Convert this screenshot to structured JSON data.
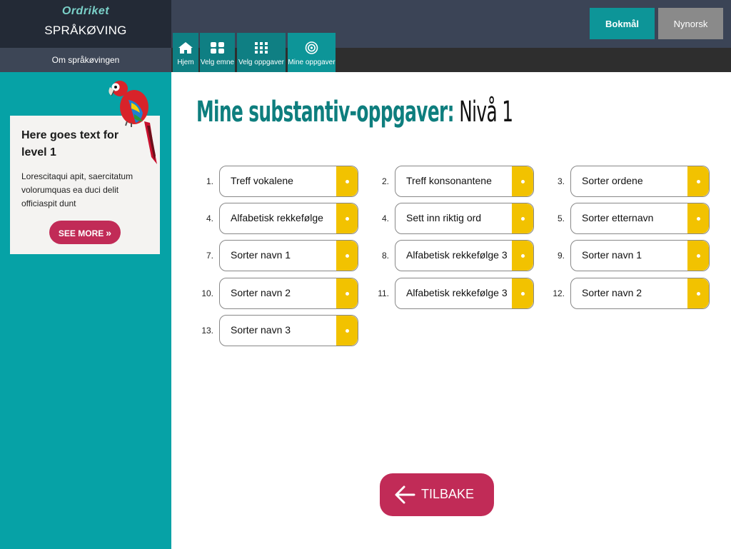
{
  "brand": {
    "logo": "Ordriket",
    "title": "SPRÅKØVING"
  },
  "about": {
    "label": "Om språkøvingen"
  },
  "language": {
    "bokmal": "Bokmål",
    "nynorsk": "Nynorsk",
    "active": "Bokmål"
  },
  "nav": [
    {
      "label": "Hjem",
      "icon": "home-icon"
    },
    {
      "label": "Velg emne",
      "icon": "grid-4-icon"
    },
    {
      "label": "Velg oppgaver",
      "icon": "grid-9-icon"
    },
    {
      "label": "Mine oppgaver",
      "icon": "target-icon",
      "active": true
    }
  ],
  "sidebar": {
    "card_title": "Here goes text for level 1",
    "card_body": "Lorescitaqui apit, saercitatum volorumquas ea duci delit officiaspit dunt",
    "see_more": "SEE MORE"
  },
  "heading": {
    "main": "Mine substantiv-oppgaver:",
    "level": "Nivå 1"
  },
  "tasks": [
    {
      "num": "1.",
      "label": "Treff vokalene"
    },
    {
      "num": "2.",
      "label": "Treff konsonantene"
    },
    {
      "num": "3.",
      "label": "Sorter ordene"
    },
    {
      "num": "4.",
      "label": "Alfabetisk rekkefølge"
    },
    {
      "num": "4.",
      "label": "Sett inn riktig ord"
    },
    {
      "num": "5.",
      "label": "Sorter etternavn"
    },
    {
      "num": "7.",
      "label": "Sorter navn 1"
    },
    {
      "num": "8.",
      "label": "Alfabetisk rekkefølge 3"
    },
    {
      "num": "9.",
      "label": "Sorter navn 1"
    },
    {
      "num": "10.",
      "label": "Sorter navn 2"
    },
    {
      "num": "11.",
      "label": "Alfabetisk rekkefølge 3"
    },
    {
      "num": "12.",
      "label": "Sorter navn 2"
    },
    {
      "num": "13.",
      "label": "Sorter navn 3"
    }
  ],
  "back": {
    "label": "TILBAKE"
  },
  "colors": {
    "teal": "#06a2a6",
    "accent": "#c12b57",
    "yellow": "#f2c200",
    "navy": "#232a36"
  }
}
